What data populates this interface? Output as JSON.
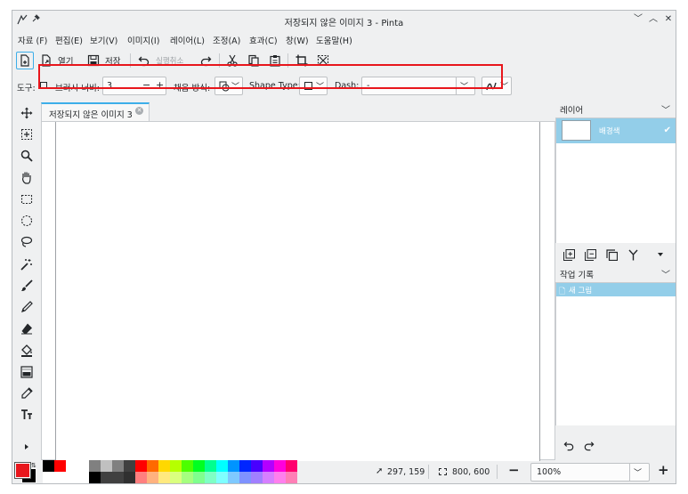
{
  "window": {
    "title": "저장되지 않은 이미지 3 - Pinta",
    "controls": [
      "﹀",
      "︿",
      "✕"
    ]
  },
  "menu": [
    "자료 (F)",
    "편집(E)",
    "보기(V)",
    "이미지(I)",
    "레이어(L)",
    "조정(A)",
    "효과(C)",
    "창(W)",
    "도움말(H)"
  ],
  "toolbar": {
    "open_label": "열기",
    "save_label": "저장",
    "undo_label": "실행취소"
  },
  "options": {
    "tool_label": "도구:",
    "brush_width_label": "브러시 너비:",
    "brush_width_value": "3",
    "minus": "−",
    "plus": "+",
    "fill_label": "채움 방식:",
    "shape_type_label": "Shape Type:",
    "dash_label": "Dash:",
    "dash_value": "-"
  },
  "tab": {
    "label": "저장되지 않은 이미지 3"
  },
  "layers": {
    "header": "레이어",
    "items": [
      {
        "name": "배경색",
        "visible": true
      }
    ]
  },
  "history": {
    "header": "작업 기록",
    "items": [
      "새 그림"
    ]
  },
  "status": {
    "cursor_pos": "297, 159",
    "selection_size": "800, 600",
    "zoom_minus": "−",
    "zoom_value": "100%",
    "zoom_plus": "+"
  },
  "colors": {
    "primary": "#e8161c",
    "secondary": "#000000",
    "accent": "#3daee9",
    "selection": "#93cee9",
    "highlight_box": "#e8161c"
  },
  "palette": {
    "top": [
      "#000000",
      "#ff0000",
      "#ffffff",
      "#ffffff",
      "#808080",
      "#c0c0c0",
      "#808080",
      "#404040",
      "#ff0000",
      "#ff6a00",
      "#ffd800",
      "#b6ff00",
      "#4cff00",
      "#00ff21",
      "#00ff90",
      "#00ffff",
      "#0094ff",
      "#0026ff",
      "#4800ff",
      "#b200ff",
      "#ff00dc",
      "#ff006e"
    ],
    "bottom": [
      "#ffffff",
      "#ffffff",
      "#ffffff",
      "#ffffff",
      "#000000",
      "#404040",
      "#404040",
      "#303030",
      "#ff7f7f",
      "#ffb27f",
      "#ffe97f",
      "#daff7f",
      "#a5ff7f",
      "#7fff8e",
      "#7fffc5",
      "#7fffff",
      "#7fc9ff",
      "#7f92ff",
      "#a17fff",
      "#d67fff",
      "#ff7fed",
      "#ff7fb6"
    ]
  }
}
